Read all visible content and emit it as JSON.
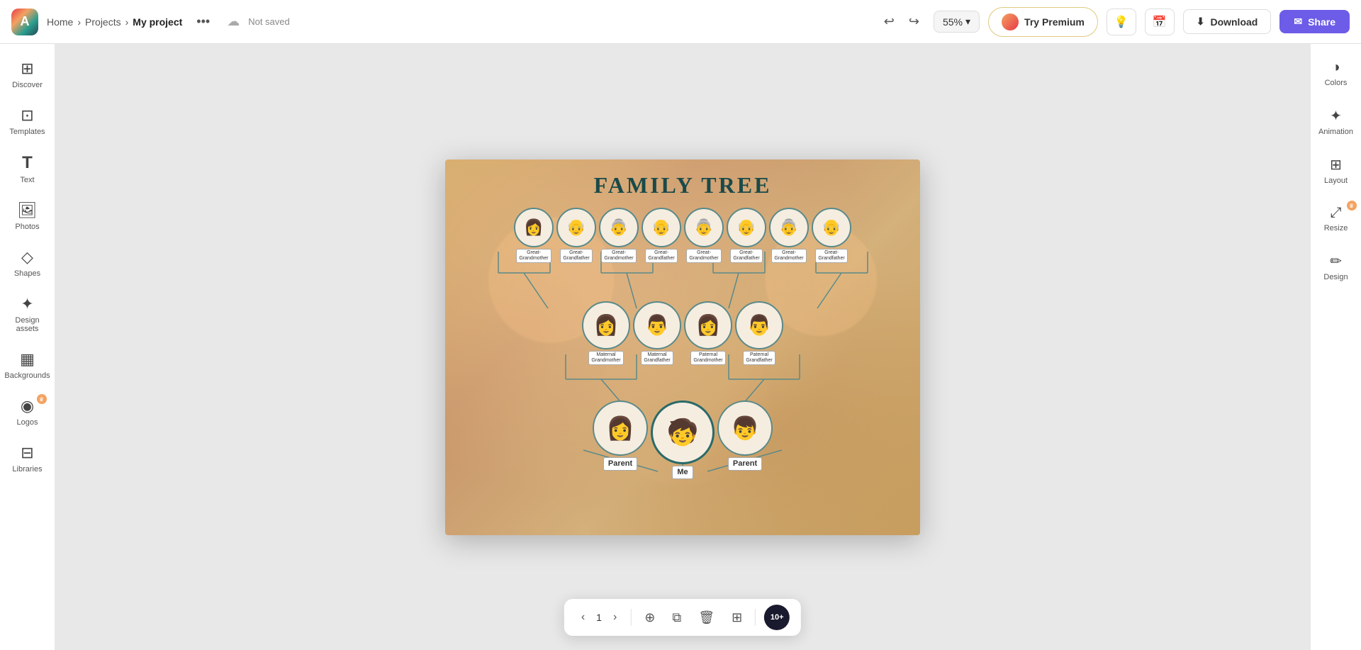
{
  "app": {
    "logo_text": "A",
    "breadcrumb": {
      "home": "Home",
      "sep1": "›",
      "projects": "Projects",
      "sep2": "›",
      "current": "My project"
    },
    "more_label": "•••",
    "not_saved": "Not saved",
    "zoom": "55%",
    "premium_label": "Try Premium",
    "download_label": "Download",
    "share_label": "Share"
  },
  "left_sidebar": {
    "items": [
      {
        "id": "discover",
        "label": "Discover",
        "icon": "⊞"
      },
      {
        "id": "templates",
        "label": "Templates",
        "icon": "⊡"
      },
      {
        "id": "text",
        "label": "Text",
        "icon": "T"
      },
      {
        "id": "photos",
        "label": "Photos",
        "icon": "🖼"
      },
      {
        "id": "shapes",
        "label": "Shapes",
        "icon": "◇"
      },
      {
        "id": "design-assets",
        "label": "Design assets",
        "icon": "✦"
      },
      {
        "id": "backgrounds",
        "label": "Backgrounds",
        "icon": "▦"
      },
      {
        "id": "logos",
        "label": "Logos",
        "icon": "◉",
        "badge": "crown"
      },
      {
        "id": "libraries",
        "label": "Libraries",
        "icon": "⊟"
      }
    ]
  },
  "right_sidebar": {
    "items": [
      {
        "id": "colors",
        "label": "Colors",
        "icon": "◑"
      },
      {
        "id": "animation",
        "label": "Animation",
        "icon": "✦"
      },
      {
        "id": "layout",
        "label": "Layout",
        "icon": "⊞"
      },
      {
        "id": "resize",
        "label": "Resize",
        "icon": "⤢",
        "badge": "crown"
      },
      {
        "id": "design",
        "label": "Design",
        "icon": "✏"
      }
    ]
  },
  "canvas": {
    "title": "FAMILY TREE",
    "row1": [
      {
        "label": "Great-\nGrandmother",
        "emoji": "👩"
      },
      {
        "label": "Great-\nGrandfather",
        "emoji": "👴"
      },
      {
        "label": "Great-\nGrandmother",
        "emoji": "👵"
      },
      {
        "label": "Great-\nGrandfather",
        "emoji": "👴"
      },
      {
        "label": "Great-\nGrandmother",
        "emoji": "👵"
      },
      {
        "label": "Great-\nGrandfather",
        "emoji": "👴"
      },
      {
        "label": "Great-\nGrandmother",
        "emoji": "👵"
      },
      {
        "label": "Great-\nGrandfather",
        "emoji": "👴"
      }
    ],
    "row2": [
      {
        "label": "Maternal\nGrandmother",
        "emoji": "👩"
      },
      {
        "label": "Maternal\nGrandfather",
        "emoji": "👨"
      },
      {
        "label": "Paternal\nGrandmother",
        "emoji": "👩"
      },
      {
        "label": "Paternal\nGrandfather",
        "emoji": "👨"
      }
    ],
    "row3": [
      {
        "label": "Parent",
        "emoji": "👩"
      },
      {
        "label": "Me",
        "emoji": "🧒"
      },
      {
        "label": "Parent",
        "emoji": "👦"
      }
    ]
  },
  "bottom_toolbar": {
    "page_num": "1",
    "counter_label": "10+"
  }
}
